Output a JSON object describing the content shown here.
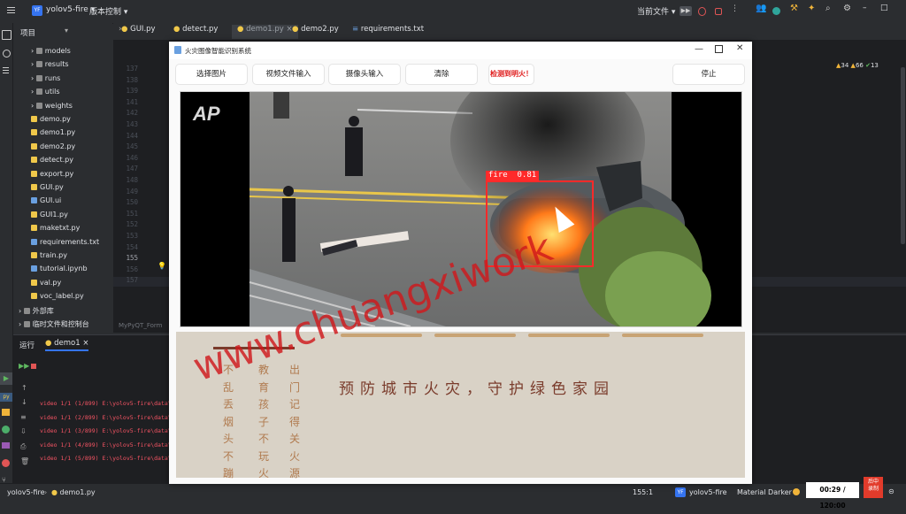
{
  "ide": {
    "project_badge": "YF",
    "project_name": "yolov5-fire",
    "vcs": "版本控制",
    "current_file": "当前文件",
    "project_panel_title": "项目",
    "tree": [
      "models",
      "results",
      "runs",
      "utils",
      "weights",
      "demo.py",
      "demo1.py",
      "demo2.py",
      "detect.py",
      "export.py",
      "GUI.py",
      "GUI.ui",
      "GUI1.py",
      "maketxt.py",
      "requirements.txt",
      "train.py",
      "tutorial.ipynb",
      "val.py",
      "voc_label.py",
      "外部库",
      "临时文件和控制台"
    ],
    "tabs": [
      "GUI.py",
      "detect.py",
      "demo1.py",
      "demo2.py",
      "requirements.txt"
    ],
    "line_numbers": [
      "137",
      "138",
      "139",
      "141",
      "142",
      "143",
      "144",
      "145",
      "146",
      "147",
      "148",
      "149",
      "150",
      "151",
      "152",
      "153",
      "154",
      "155",
      "156",
      "157"
    ],
    "breadcrumb": "MyPyQT_Form",
    "inspections": {
      "warnings": "34",
      "weak": "66",
      "ok": "13"
    },
    "run_label": "运行",
    "run_tab": "demo1",
    "run_lines": [
      "video 1/1 (1/899) E:\\yolov5-fire\\data\\",
      "video 1/1 (2/899) E:\\yolov5-fire\\data\\",
      "video 1/1 (3/899) E:\\yolov5-fire\\data\\",
      "video 1/1 (4/899) E:\\yolov5-fire\\data\\",
      "video 1/1 (5/899) E:\\yolov5-fire\\data\\"
    ],
    "status": {
      "project": "yolov5-fire",
      "file": "demo1.py",
      "position": "155:1",
      "interpreter": "yolov5-fire",
      "theme": "Material Darker",
      "recording_time": "00:29 / 120:00",
      "record_badge": "后中\n录制"
    }
  },
  "app": {
    "title": "火灾图像智能识别系统",
    "buttons": [
      "选择图片",
      "视频文件输入",
      "摄像头输入",
      "清除",
      "检测到明火！",
      "停止"
    ],
    "detection": {
      "label": "fire  0.81"
    },
    "logo": "AP",
    "watermark": "www.chuangxiwork",
    "poster_slogan": "预防城市火灾，守护绿色家园",
    "poster_columns": [
      "不乱丢烟头不蹦",
      "教育孩子不玩火",
      "出门记得关火源"
    ]
  },
  "colors": {
    "accent": "#3574f0",
    "alert": "#e02020",
    "bbox": "#ff2a2a",
    "watermark": "#d0181c"
  }
}
